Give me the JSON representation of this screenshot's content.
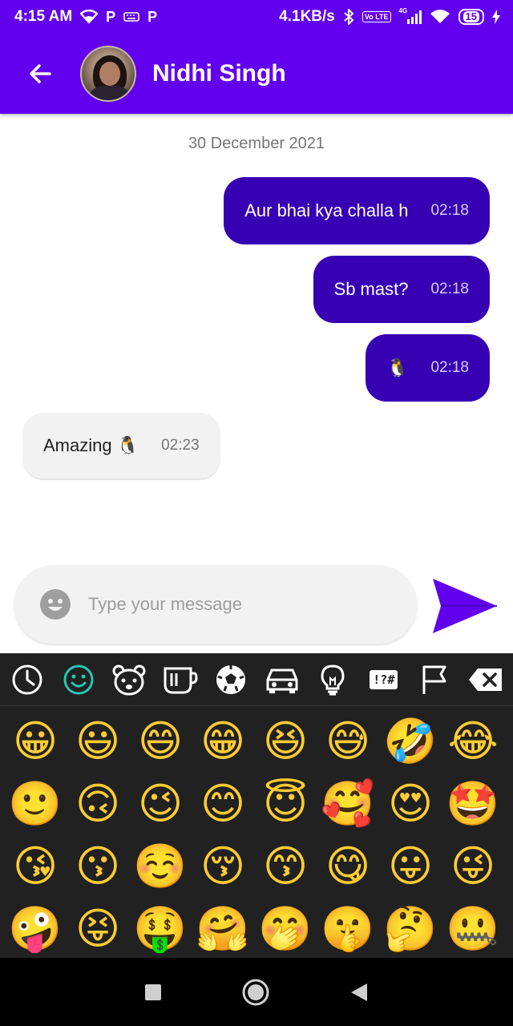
{
  "status_bar": {
    "time": "4:15 AM",
    "left_icons": [
      "wifi-icon",
      "p-icon",
      "keyboard-icon",
      "p-icon"
    ],
    "network_speed": "4.1KB/s",
    "volte": "Vo LTE",
    "network_type": "4G",
    "battery_level": "15"
  },
  "header": {
    "contact_name": "Nidhi Singh"
  },
  "chat": {
    "date_label": "30 December 2021",
    "messages": [
      {
        "direction": "outgoing",
        "text": "Aur bhai kya challa h",
        "time": "02:18"
      },
      {
        "direction": "outgoing",
        "text": "Sb mast?",
        "time": "02:18"
      },
      {
        "direction": "outgoing",
        "text": "🐧",
        "time": "02:18"
      },
      {
        "direction": "incoming",
        "text": "Amazing 🐧",
        "time": "02:23"
      }
    ]
  },
  "composer": {
    "placeholder": "Type your message"
  },
  "keyboard": {
    "tabs": [
      "clock-icon",
      "smiley-icon",
      "bear-icon",
      "cup-icon",
      "soccer-ball-icon",
      "car-icon",
      "lightbulb-icon",
      "symbols-icon",
      "flag-icon",
      "backspace-icon"
    ],
    "symbols_label": "!?#",
    "emojis": [
      "😀",
      "😃",
      "😄",
      "😁",
      "😆",
      "😅",
      "🤣",
      "😂",
      "🙂",
      "🙃",
      "😉",
      "😊",
      "😇",
      "🥰",
      "😍",
      "🤩",
      "😘",
      "😗",
      "☺️",
      "😚",
      "😙",
      "😋",
      "😛",
      "😜",
      "🤪",
      "😝",
      "🤑",
      "🤗",
      "🤭",
      "🤫",
      "🤔",
      "🤐"
    ]
  },
  "colors": {
    "primary": "#6200ee",
    "outgoing_bubble": "#3700b3",
    "incoming_bubble": "#f2f2f2",
    "keyboard_bg": "#212121",
    "accent_teal": "#26c6b0"
  }
}
